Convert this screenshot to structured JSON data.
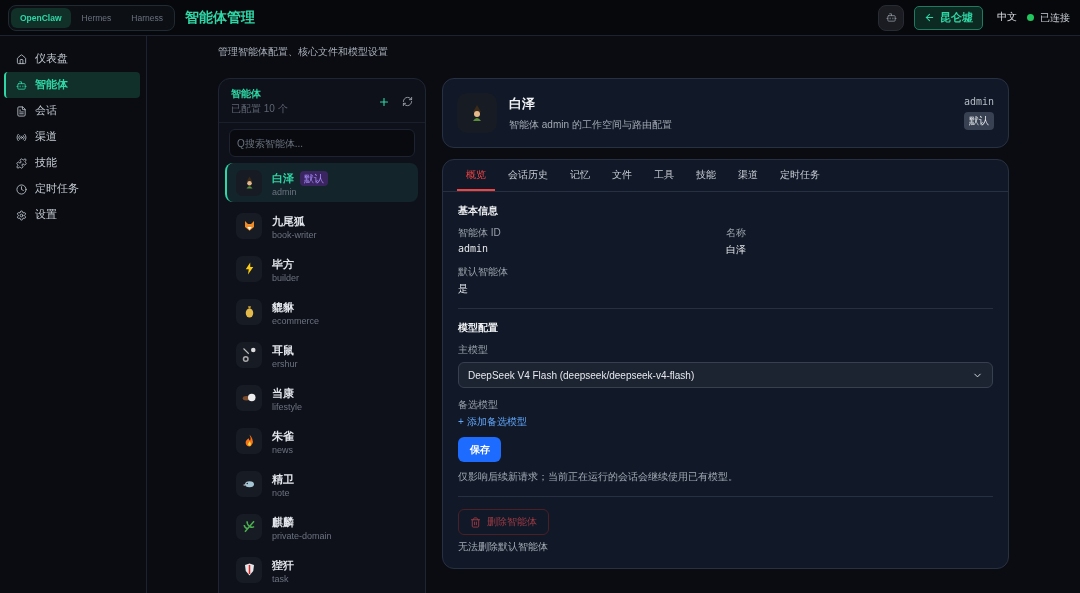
{
  "top_bar": {
    "frameworks": [
      {
        "label": "OpenClaw",
        "selected": true
      },
      {
        "label": "Hermes",
        "selected": false
      },
      {
        "label": "Harness",
        "selected": false
      }
    ],
    "title": "智能体管理",
    "back_button": "昆仑墟",
    "language": "中文",
    "status": {
      "label": "已连接",
      "connected": true
    }
  },
  "sidebar": {
    "items": [
      {
        "label": "仪表盘",
        "selected": false
      },
      {
        "label": "智能体",
        "selected": true
      },
      {
        "label": "会话",
        "selected": false
      },
      {
        "label": "渠道",
        "selected": false
      },
      {
        "label": "技能",
        "selected": false
      },
      {
        "label": "定时任务",
        "selected": false
      },
      {
        "label": "设置",
        "selected": false
      }
    ]
  },
  "page": {
    "subtitle": "管理智能体配置、核心文件和模型设置"
  },
  "agent_list": {
    "title": "智能体",
    "count": "已配置 10 个",
    "search": {
      "placeholder": "Q搜索智能体..."
    },
    "agents": [
      {
        "name": "白泽",
        "id": "admin",
        "badge": "默认",
        "selected": true
      },
      {
        "name": "九尾狐",
        "id": "book-writer",
        "selected": false
      },
      {
        "name": "毕方",
        "id": "builder",
        "selected": false
      },
      {
        "name": "貔貅",
        "id": "ecommerce",
        "selected": false
      },
      {
        "name": "耳鼠",
        "id": "ershur",
        "selected": false
      },
      {
        "name": "当康",
        "id": "lifestyle",
        "selected": false
      },
      {
        "name": "朱雀",
        "id": "news",
        "selected": false
      },
      {
        "name": "精卫",
        "id": "note",
        "selected": false
      },
      {
        "name": "麒麟",
        "id": "private-domain",
        "selected": false
      },
      {
        "name": "狴犴",
        "id": "task",
        "selected": false
      }
    ]
  },
  "agent_header": {
    "name": "白泽",
    "description": "智能体 admin 的工作空间与路由配置",
    "id": "admin",
    "badge": "默认"
  },
  "tabs": [
    {
      "label": "概览",
      "selected": true
    },
    {
      "label": "会话历史",
      "selected": false
    },
    {
      "label": "记忆",
      "selected": false
    },
    {
      "label": "文件",
      "selected": false
    },
    {
      "label": "工具",
      "selected": false
    },
    {
      "label": "技能",
      "selected": false
    },
    {
      "label": "渠道",
      "selected": false
    },
    {
      "label": "定时任务",
      "selected": false
    }
  ],
  "basic_info": {
    "title": "基本信息",
    "fields": [
      {
        "label": "智能体 ID",
        "value": "admin"
      },
      {
        "label": "名称",
        "value": "白泽"
      },
      {
        "label": "默认智能体",
        "value": "是"
      }
    ]
  },
  "model_config": {
    "title": "模型配置",
    "primary_label": "主模型",
    "primary_value": "DeepSeek V4 Flash (deepseek/deepseek-v4-flash)",
    "fallback_label": "备选模型",
    "add_fallback": "+ 添加备选模型",
    "save": "保存",
    "note": "仅影响后续新请求；当前正在运行的会话会继续使用已有模型。"
  },
  "danger": {
    "delete_button": "删除智能体",
    "disabled": true,
    "note": "无法删除默认智能体"
  }
}
